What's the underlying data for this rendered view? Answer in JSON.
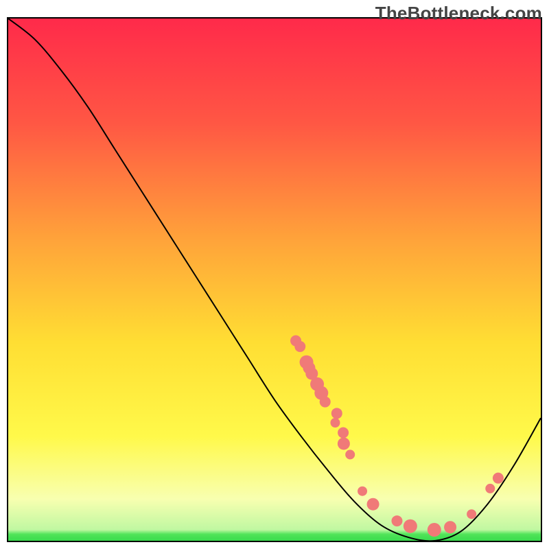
{
  "watermark": "TheBottleneck.com",
  "chart_data": {
    "type": "line",
    "title": "",
    "curve": [
      {
        "x": 0.0,
        "y": 1.0
      },
      {
        "x": 0.05,
        "y": 0.96
      },
      {
        "x": 0.1,
        "y": 0.9
      },
      {
        "x": 0.15,
        "y": 0.83
      },
      {
        "x": 0.2,
        "y": 0.75
      },
      {
        "x": 0.25,
        "y": 0.67
      },
      {
        "x": 0.3,
        "y": 0.59
      },
      {
        "x": 0.35,
        "y": 0.51
      },
      {
        "x": 0.4,
        "y": 0.43
      },
      {
        "x": 0.45,
        "y": 0.35
      },
      {
        "x": 0.5,
        "y": 0.27
      },
      {
        "x": 0.55,
        "y": 0.2
      },
      {
        "x": 0.6,
        "y": 0.135
      },
      {
        "x": 0.65,
        "y": 0.075
      },
      {
        "x": 0.7,
        "y": 0.03
      },
      {
        "x": 0.75,
        "y": 0.007
      },
      {
        "x": 0.8,
        "y": 0.0
      },
      {
        "x": 0.85,
        "y": 0.018
      },
      {
        "x": 0.9,
        "y": 0.07
      },
      {
        "x": 0.95,
        "y": 0.145
      },
      {
        "x": 1.0,
        "y": 0.235
      }
    ],
    "markers": [
      {
        "x": 0.54,
        "y": 0.383,
        "r": 8
      },
      {
        "x": 0.548,
        "y": 0.372,
        "r": 8
      },
      {
        "x": 0.56,
        "y": 0.342,
        "r": 10
      },
      {
        "x": 0.565,
        "y": 0.331,
        "r": 9
      },
      {
        "x": 0.57,
        "y": 0.32,
        "r": 9
      },
      {
        "x": 0.58,
        "y": 0.3,
        "r": 10
      },
      {
        "x": 0.588,
        "y": 0.283,
        "r": 10
      },
      {
        "x": 0.595,
        "y": 0.266,
        "r": 8
      },
      {
        "x": 0.617,
        "y": 0.244,
        "r": 8
      },
      {
        "x": 0.614,
        "y": 0.226,
        "r": 7
      },
      {
        "x": 0.629,
        "y": 0.207,
        "r": 8
      },
      {
        "x": 0.63,
        "y": 0.186,
        "r": 9
      },
      {
        "x": 0.642,
        "y": 0.165,
        "r": 7
      },
      {
        "x": 0.665,
        "y": 0.095,
        "r": 7
      },
      {
        "x": 0.685,
        "y": 0.07,
        "r": 9
      },
      {
        "x": 0.73,
        "y": 0.038,
        "r": 8
      },
      {
        "x": 0.755,
        "y": 0.028,
        "r": 10
      },
      {
        "x": 0.8,
        "y": 0.021,
        "r": 10
      },
      {
        "x": 0.83,
        "y": 0.026,
        "r": 9
      },
      {
        "x": 0.87,
        "y": 0.051,
        "r": 7
      },
      {
        "x": 0.905,
        "y": 0.1,
        "r": 7
      },
      {
        "x": 0.92,
        "y": 0.12,
        "r": 8
      }
    ],
    "xlim": [
      0,
      1
    ],
    "ylim": [
      0,
      1
    ],
    "xlabel": "",
    "ylabel": "",
    "gradient_stops": [
      {
        "offset": 0.0,
        "color": "#ff2a4a"
      },
      {
        "offset": 0.2,
        "color": "#ff5744"
      },
      {
        "offset": 0.42,
        "color": "#ffa23a"
      },
      {
        "offset": 0.62,
        "color": "#ffde33"
      },
      {
        "offset": 0.8,
        "color": "#fff94a"
      },
      {
        "offset": 0.92,
        "color": "#f8ffb0"
      },
      {
        "offset": 0.985,
        "color": "#baf7a0"
      },
      {
        "offset": 1.0,
        "color": "#3bdc4e"
      }
    ],
    "curve_stroke": "#000000",
    "marker_fill": "#f07a78"
  }
}
